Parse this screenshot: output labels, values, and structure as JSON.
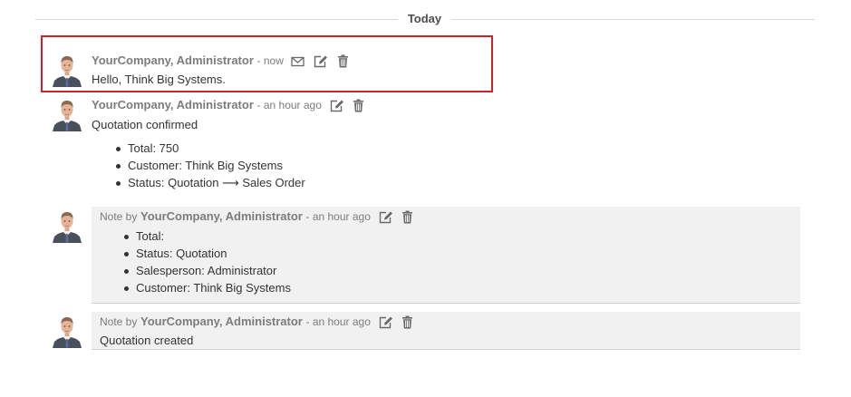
{
  "divider": {
    "label": "Today"
  },
  "messages": [
    {
      "author": "YourCompany, Administrator",
      "date": "- now",
      "body": "Hello, Think Big Systems."
    },
    {
      "author": "YourCompany, Administrator",
      "date": "- an hour ago",
      "body": "Quotation confirmed",
      "tracking": [
        {
          "text": "Total: 750"
        },
        {
          "text": "Customer: Think Big Systems"
        },
        {
          "field": "Status: ",
          "old": "Quotation",
          "arrow": "⟶",
          "new": "Sales Order"
        }
      ]
    },
    {
      "prefix": "Note by",
      "author": "YourCompany, Administrator",
      "date": "- an hour ago",
      "tracking": [
        {
          "text": "Total:"
        },
        {
          "text": "Status: Quotation"
        },
        {
          "text": "Salesperson: Administrator"
        },
        {
          "text": "Customer: Think Big Systems"
        }
      ]
    },
    {
      "prefix": "Note by",
      "author": "YourCompany, Administrator",
      "date": "- an hour ago",
      "body": "Quotation created"
    }
  ],
  "icons": {
    "envelope": "envelope-icon",
    "edit": "edit-icon",
    "delete": "trash-icon",
    "avatar": "avatar-portrait"
  },
  "colors": {
    "highlight_border": "#d0202c",
    "note_background": "#f1f1f1",
    "author": "#7c7c7c",
    "text": "#333333"
  }
}
